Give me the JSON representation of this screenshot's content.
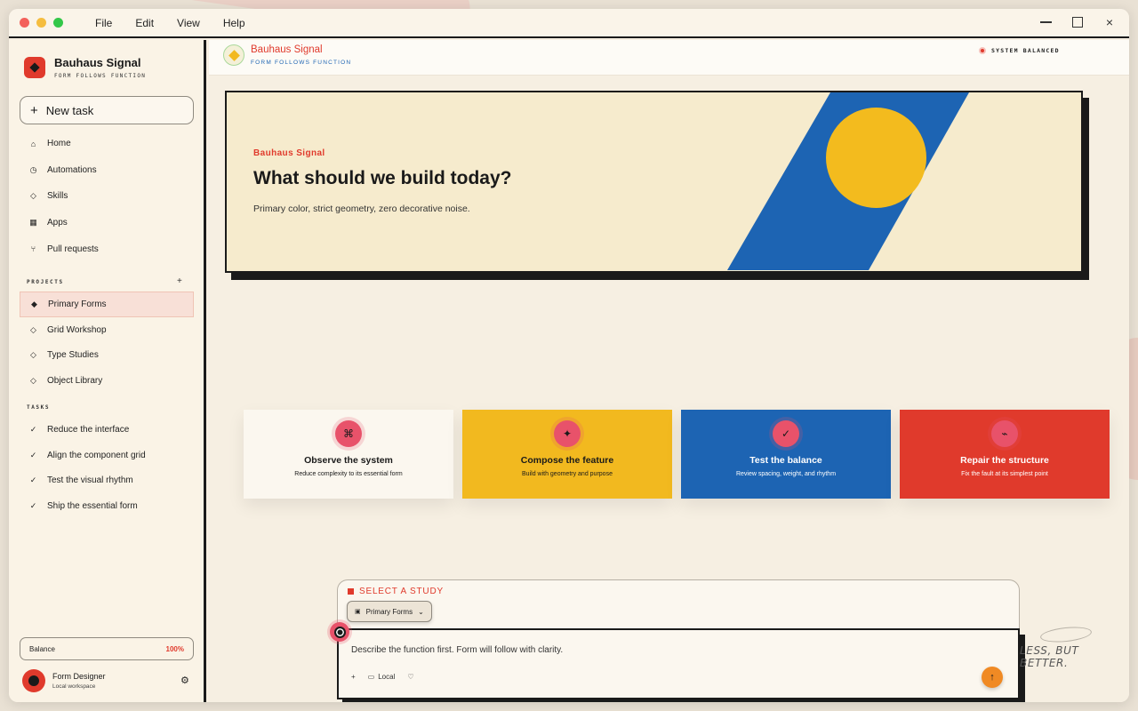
{
  "menu": [
    "File",
    "Edit",
    "View",
    "Help"
  ],
  "window_controls": {
    "close": "×"
  },
  "brand": {
    "title": "Bauhaus Signal",
    "subtitle": "Form follows function"
  },
  "new_task": {
    "label": "New task",
    "icon": "plus-icon"
  },
  "nav": [
    {
      "label": "Home",
      "icon": "⌂"
    },
    {
      "label": "Automations",
      "icon": "◷"
    },
    {
      "label": "Skills",
      "icon": "◇"
    },
    {
      "label": "Apps",
      "icon": "▦"
    },
    {
      "label": "Pull requests",
      "icon": "⑂"
    }
  ],
  "projects": {
    "heading": "Projects",
    "add": "+",
    "items": [
      {
        "label": "Primary Forms",
        "icon": "◆",
        "active": true
      },
      {
        "label": "Grid Workshop",
        "icon": "◇"
      },
      {
        "label": "Type Studies",
        "icon": "◇"
      },
      {
        "label": "Object Library",
        "icon": "◇"
      }
    ]
  },
  "tasks": {
    "heading": "Tasks",
    "items": [
      {
        "label": "Reduce the interface",
        "icon": "✓"
      },
      {
        "label": "Align the component grid",
        "icon": "✓"
      },
      {
        "label": "Test the visual rhythm",
        "icon": "✓"
      },
      {
        "label": "Ship the essential form",
        "icon": "✓"
      }
    ]
  },
  "balance": {
    "label": "Balance",
    "value": "100%"
  },
  "user": {
    "name": "Form Designer",
    "workspace": "Local workspace",
    "settings_icon": "⚙"
  },
  "topbar": {
    "title": "Bauhaus Signal",
    "subtitle": "Form follows function",
    "status": "System balanced"
  },
  "hero": {
    "eyebrow": "Bauhaus Signal",
    "title": "What should we build today?",
    "subtitle": "Primary color, strict geometry, zero decorative noise."
  },
  "cards": [
    {
      "title": "Observe the system",
      "subtitle": "Reduce complexity to its essential form",
      "icon": "⌘",
      "style": "c-white"
    },
    {
      "title": "Compose the feature",
      "subtitle": "Build with geometry and purpose",
      "icon": "✦",
      "style": "c-yellow"
    },
    {
      "title": "Test the balance",
      "subtitle": "Review spacing, weight, and rhythm",
      "icon": "✓",
      "style": "c-blue"
    },
    {
      "title": "Repair the structure",
      "subtitle": "Fix the fault at its simplest point",
      "icon": "⌁",
      "style": "c-red"
    }
  ],
  "composer": {
    "study_label": "Select a study",
    "study_value": "Primary Forms",
    "study_icon": "▣",
    "chevron": "⌄",
    "placeholder": "Describe the function first. Form will follow with clarity.",
    "add_icon": "+",
    "local_icon": "▭",
    "local_label": "Local",
    "shield_icon": "♡",
    "send_icon": "↑"
  },
  "tagline": "LESS, BUT BETTER.",
  "colors": {
    "red": "#e03a2c",
    "yellow": "#f2b91f",
    "blue": "#1d64b3",
    "ink": "#1a1a1a",
    "paper": "#f6ebcd"
  }
}
